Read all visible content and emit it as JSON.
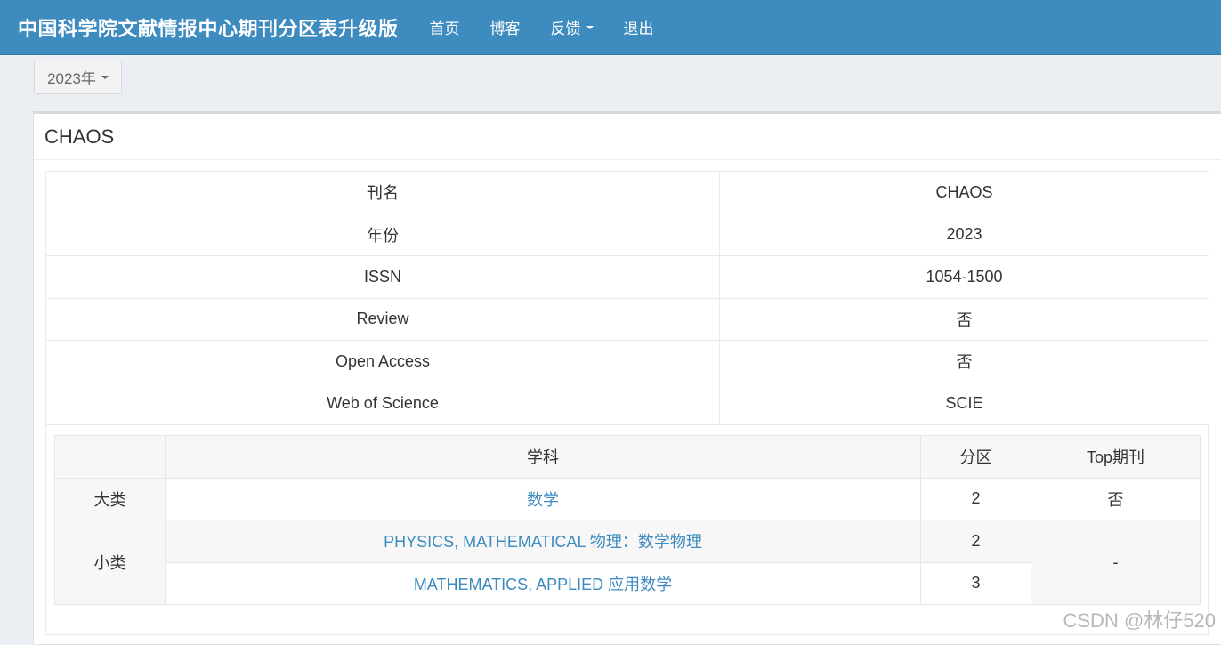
{
  "header": {
    "brand": "中国科学院文献情报中心期刊分区表升级版",
    "nav": [
      {
        "label": "首页"
      },
      {
        "label": "博客"
      },
      {
        "label": "反馈",
        "dropdown": true
      },
      {
        "label": "退出"
      }
    ]
  },
  "year_select": {
    "value": "2023年"
  },
  "journal": {
    "title": "CHAOS",
    "info": [
      {
        "label": "刊名",
        "value": "CHAOS"
      },
      {
        "label": "年份",
        "value": "2023"
      },
      {
        "label": "ISSN",
        "value": "1054-1500"
      },
      {
        "label": "Review",
        "value": "否"
      },
      {
        "label": "Open Access",
        "value": "否"
      },
      {
        "label": "Web of Science",
        "value": "SCIE"
      }
    ]
  },
  "partition": {
    "headers": {
      "subject": "学科",
      "zone": "分区",
      "top": "Top期刊"
    },
    "major": {
      "label": "大类",
      "subject": "数学",
      "zone": "2",
      "top": "否"
    },
    "minor": {
      "label": "小类",
      "rows": [
        {
          "subject": "PHYSICS, MATHEMATICAL 物理：数学物理",
          "zone": "2"
        },
        {
          "subject": "MATHEMATICS, APPLIED 应用数学",
          "zone": "3"
        }
      ],
      "top": "-"
    }
  },
  "watermark": "CSDN @林仔520"
}
